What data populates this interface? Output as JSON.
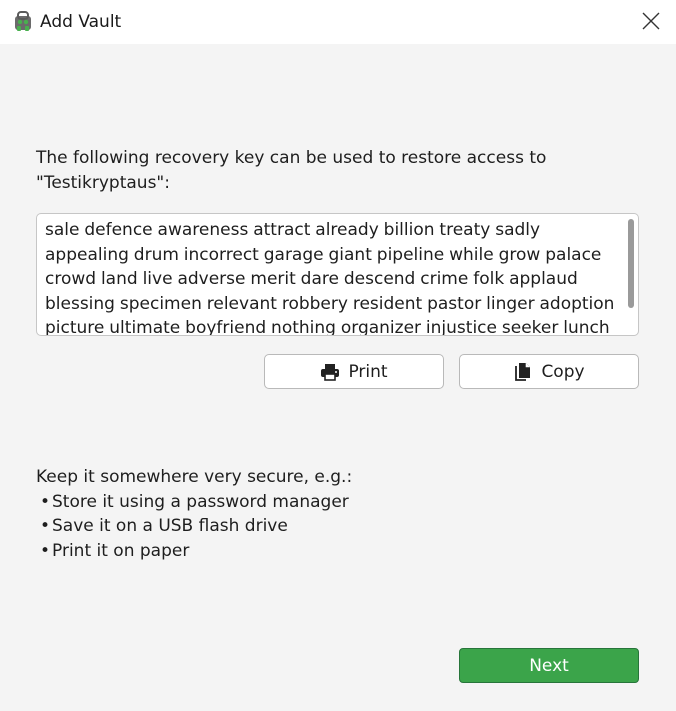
{
  "window": {
    "title": "Add Vault",
    "close_icon": "close-icon"
  },
  "intro": {
    "line1": "The following recovery key can be used to restore access to",
    "line2": "\"Testikryptaus\":"
  },
  "recovery_key": {
    "lines": [
      "sale defence awareness attract already billion treaty sadly",
      "appealing drum incorrect garage giant pipeline while grow palace",
      "crowd land live adverse merit dare descend crime folk applaud",
      "blessing specimen relevant robbery resident pastor linger adoption",
      "picture ultimate boyfriend nothing organizer injustice seeker lunch"
    ]
  },
  "actions": {
    "print_label": "Print",
    "copy_label": "Copy",
    "print_icon": "printer-icon",
    "copy_icon": "copy-icon"
  },
  "tips": {
    "heading": "Keep it somewhere very secure, e.g.:",
    "bullet": "•",
    "items": [
      "Store it using a password manager",
      "Save it on a USB flash drive",
      "Print it on paper"
    ]
  },
  "footer": {
    "next_label": "Next"
  },
  "colors": {
    "accent_green": "#3ba44a",
    "accent_green_border": "#27753a",
    "background": "#f4f4f4",
    "titlebar": "#ffffff"
  }
}
